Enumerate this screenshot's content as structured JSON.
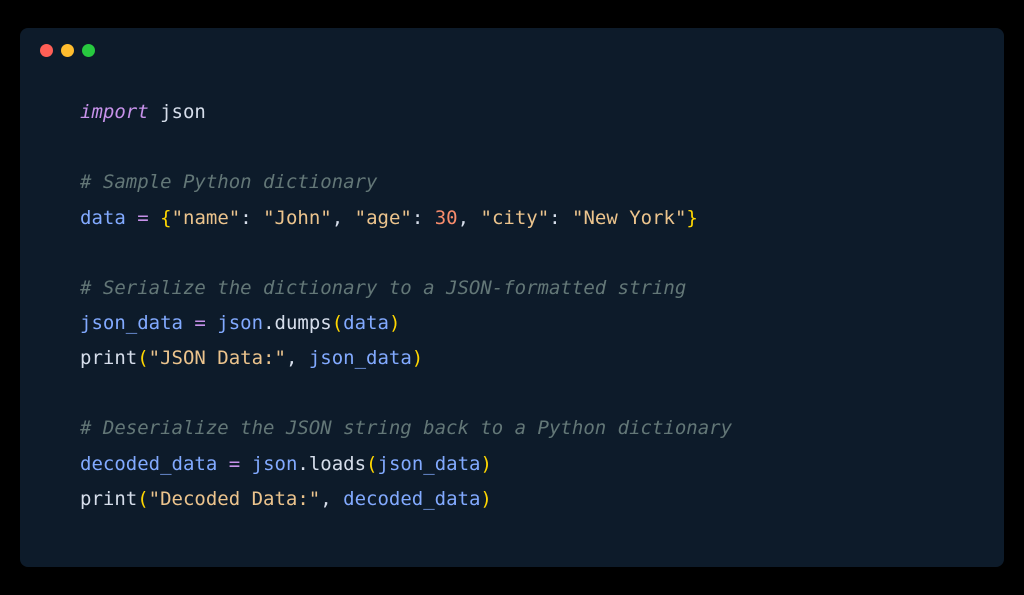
{
  "code": {
    "line1": {
      "import_kw": "import",
      "module": " json"
    },
    "line2": {
      "comment": "# Sample Python dictionary"
    },
    "line3": {
      "var": "data ",
      "eq": "=",
      "sp": " ",
      "lbrace": "{",
      "k1": "\"name\"",
      "c1": ": ",
      "v1": "\"John\"",
      "cm1": ", ",
      "k2": "\"age\"",
      "c2": ": ",
      "v2": "30",
      "cm2": ", ",
      "k3": "\"city\"",
      "c3": ": ",
      "v3": "\"New York\"",
      "rbrace": "}"
    },
    "line4": {
      "comment": "# Serialize the dictionary to a JSON-formatted string"
    },
    "line5": {
      "var": "json_data ",
      "eq": "=",
      "sp": " ",
      "obj": "json",
      "dot": ".",
      "method": "dumps",
      "lp": "(",
      "arg": "data",
      "rp": ")"
    },
    "line6": {
      "fn": "print",
      "lp": "(",
      "str": "\"JSON Data:\"",
      "cm": ", ",
      "arg": "json_data",
      "rp": ")"
    },
    "line7": {
      "comment": "# Deserialize the JSON string back to a Python dictionary"
    },
    "line8": {
      "var": "decoded_data ",
      "eq": "=",
      "sp": " ",
      "obj": "json",
      "dot": ".",
      "method": "loads",
      "lp": "(",
      "arg": "json_data",
      "rp": ")"
    },
    "line9": {
      "fn": "print",
      "lp": "(",
      "str": "\"Decoded Data:\"",
      "cm": ", ",
      "arg": "decoded_data",
      "rp": ")"
    }
  }
}
